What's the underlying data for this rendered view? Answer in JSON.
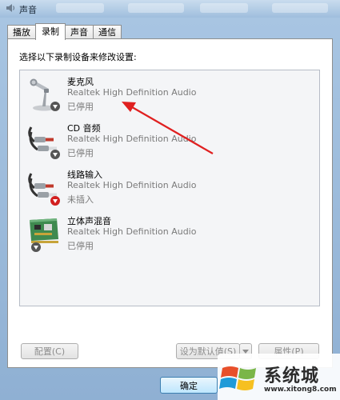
{
  "window": {
    "title": "声音"
  },
  "tabs": [
    {
      "label": "播放",
      "active": false
    },
    {
      "label": "录制",
      "active": true
    },
    {
      "label": "声音",
      "active": false
    },
    {
      "label": "通信",
      "active": false
    }
  ],
  "main": {
    "instruction": "选择以下录制设备来修改设置:",
    "devices": [
      {
        "name": "麦克风",
        "driver": "Realtek High Definition Audio",
        "status": "已停用",
        "icon": "microphone-icon",
        "badge": "disabled-arrow-icon"
      },
      {
        "name": "CD 音频",
        "driver": "Realtek High Definition Audio",
        "status": "已停用",
        "icon": "rca-cable-icon",
        "badge": "disabled-arrow-icon"
      },
      {
        "name": "线路输入",
        "driver": "Realtek High Definition Audio",
        "status": "未插入",
        "icon": "rca-cable-icon",
        "badge": "unplugged-arrow-icon"
      },
      {
        "name": "立体声混音",
        "driver": "Realtek High Definition Audio",
        "status": "已停用",
        "icon": "sound-card-icon",
        "badge": "disabled-arrow-icon"
      }
    ]
  },
  "buttons": {
    "configure": "配置(C)",
    "set_default": "设为默认值(S)",
    "properties": "属性(P)",
    "ok": "确定"
  },
  "watermark": {
    "text_cn": "系统城",
    "url": "www.xitong8.com"
  },
  "colors": {
    "annotation_arrow": "#e02020",
    "badge_disabled": "#555555",
    "badge_unplugged": "#d22020"
  }
}
